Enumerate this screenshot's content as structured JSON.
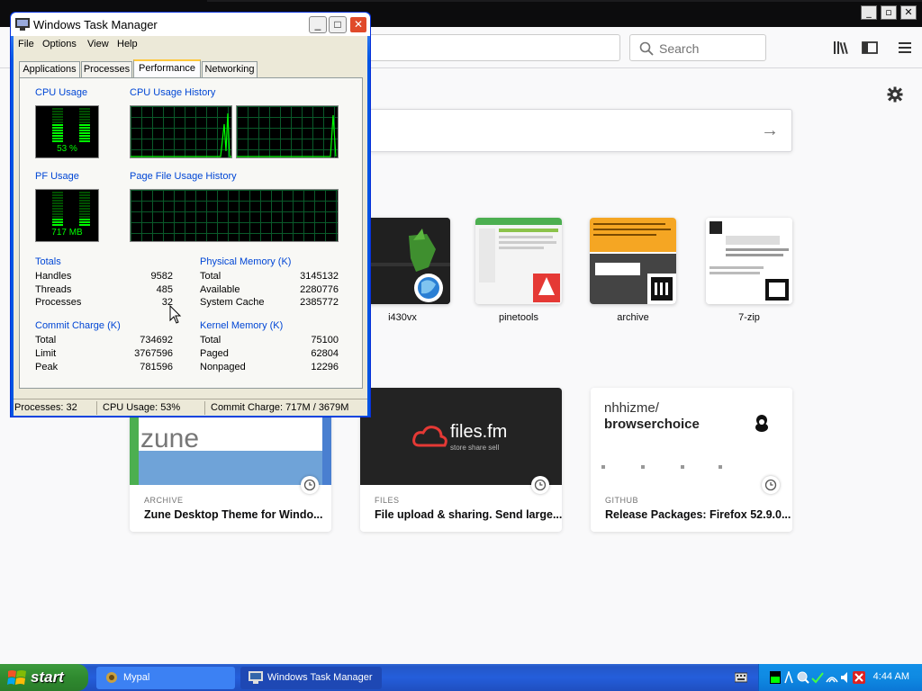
{
  "firefox": {
    "search_placeholder": "Search"
  },
  "top_sites": [
    {
      "label": "i430vx"
    },
    {
      "label": "pinetools"
    },
    {
      "label": "archive"
    },
    {
      "label": "7-zip"
    }
  ],
  "highlights": [
    {
      "source": "ARCHIVE",
      "title": "Zune Desktop Theme for Windo...",
      "image_text": "zune"
    },
    {
      "source": "FILES",
      "title": "File upload & sharing. Send large...",
      "image_text": "files.fm",
      "image_sub": "store share sell"
    },
    {
      "source": "GITHUB",
      "title": "Release Packages: Firefox 52.9.0...",
      "image_text_1": "nhhizme/",
      "image_text_2": "browserchoice"
    }
  ],
  "task_manager": {
    "title": "Windows Task Manager",
    "menu": [
      "File",
      "Options",
      "View",
      "Help"
    ],
    "tabs": [
      "Applications",
      "Processes",
      "Performance",
      "Networking"
    ],
    "selected_tab": "Performance",
    "cpu_usage_label": "CPU Usage",
    "cpu_usage_value": "53 %",
    "cpu_history_label": "CPU Usage History",
    "pf_usage_label": "PF Usage",
    "pf_usage_value": "717 MB",
    "pf_history_label": "Page File Usage History",
    "cpu_usage_level": 0.53,
    "totals": {
      "header": "Totals",
      "rows": [
        {
          "label": "Handles",
          "value": "9582"
        },
        {
          "label": "Threads",
          "value": "485"
        },
        {
          "label": "Processes",
          "value": "32"
        }
      ]
    },
    "physical_memory": {
      "header": "Physical Memory (K)",
      "rows": [
        {
          "label": "Total",
          "value": "3145132"
        },
        {
          "label": "Available",
          "value": "2280776"
        },
        {
          "label": "System Cache",
          "value": "2385772"
        }
      ]
    },
    "commit_charge": {
      "header": "Commit Charge (K)",
      "rows": [
        {
          "label": "Total",
          "value": "734692"
        },
        {
          "label": "Limit",
          "value": "3767596"
        },
        {
          "label": "Peak",
          "value": "781596"
        }
      ]
    },
    "kernel_memory": {
      "header": "Kernel Memory (K)",
      "rows": [
        {
          "label": "Total",
          "value": "75100"
        },
        {
          "label": "Paged",
          "value": "62804"
        },
        {
          "label": "Nonpaged",
          "value": "12296"
        }
      ]
    },
    "status": {
      "processes": "Processes: 32",
      "cpu": "CPU Usage: 53%",
      "commit": "Commit Charge: 717M / 3679M"
    }
  },
  "taskbar": {
    "start_label": "start",
    "buttons": [
      "Mypal",
      "Windows Task Manager"
    ],
    "clock": "4:44 AM"
  }
}
